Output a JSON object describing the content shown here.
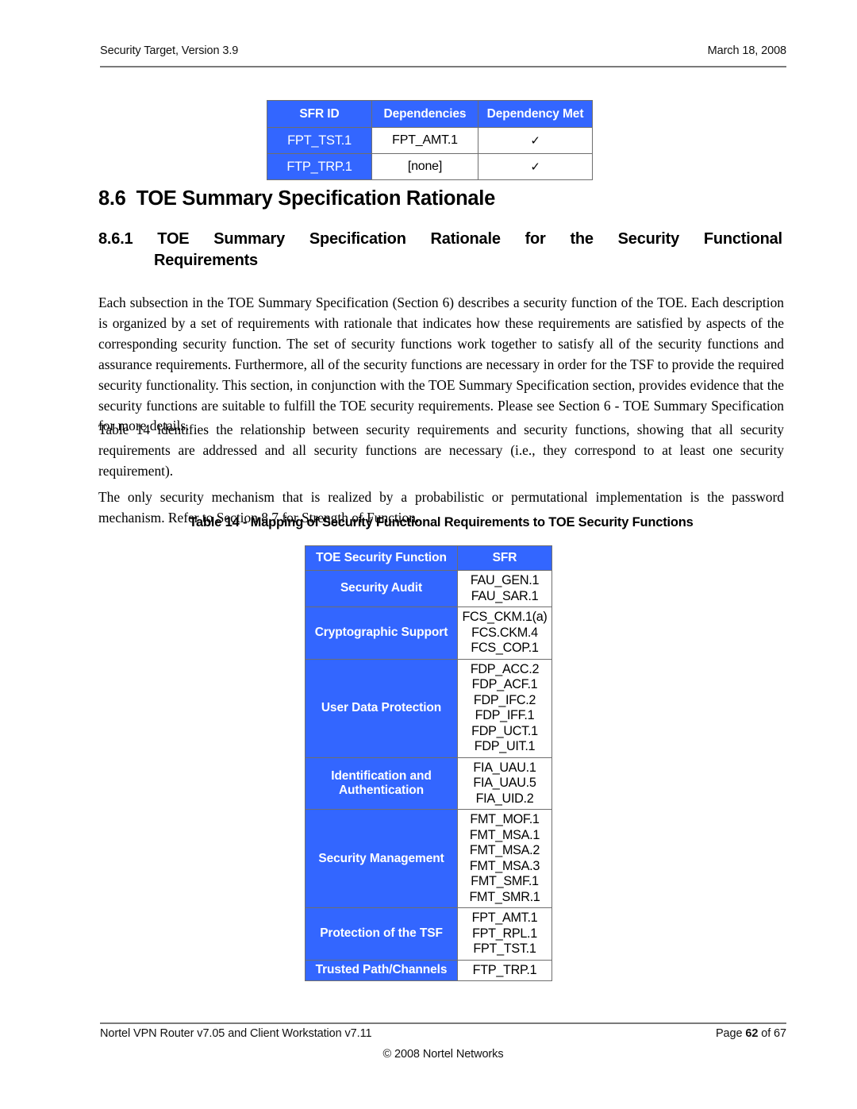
{
  "header": {
    "left": "Security Target, Version 3.9",
    "right": "March 18, 2008"
  },
  "dependency_table": {
    "columns": [
      "SFR ID",
      "Dependencies",
      "Dependency Met"
    ],
    "rows": [
      {
        "sfr_id": "FPT_TST.1",
        "dependencies": "FPT_AMT.1",
        "met": "✓"
      },
      {
        "sfr_id": "FTP_TRP.1",
        "dependencies": "[none]",
        "met": "✓"
      }
    ]
  },
  "heading_8_6": {
    "number": "8.6",
    "text": "TOE Summary Specification Rationale"
  },
  "heading_8_6_1": {
    "number": "8.6.1",
    "line1_words": [
      "TOE",
      "Summary",
      "Specification",
      "Rationale",
      "for",
      "the",
      "Security",
      "Functional"
    ],
    "line2": "Requirements"
  },
  "paragraphs": {
    "p1": "Each subsection in the TOE Summary Specification (Section 6) describes a security function of the TOE.  Each description is organized by a set of requirements with rationale that indicates how these requirements are satisfied by aspects of the corresponding security function.  The set of security functions work together to satisfy all of the security functions and assurance requirements.  Furthermore, all of the security functions are necessary in order for the TSF to provide the required security functionality.  This section, in conjunction with the TOE Summary Specification section, provides evidence that the security functions are suitable to fulfill the TOE security requirements.  Please see Section 6 - TOE Summary Specification for more details.",
    "p2": "Table 14 identifies the relationship between security requirements and security functions, showing that all security requirements are addressed and all security functions are necessary (i.e., they correspond to at least one security requirement).",
    "p3": "The only security mechanism that is realized by a probabilistic or permutational implementation is the password mechanism.  Refer to Section 8.7 for Strength of Function."
  },
  "table14": {
    "caption": "Table 14 - Mapping of Security Functional Requirements to TOE Security Functions",
    "columns": [
      "TOE Security Function",
      "SFR"
    ],
    "rows": [
      {
        "function": "Security Audit",
        "sfrs": [
          "FAU_GEN.1",
          "FAU_SAR.1"
        ]
      },
      {
        "function": "Cryptographic Support",
        "sfrs": [
          "FCS_CKM.1(a)",
          "FCS.CKM.4",
          "FCS_COP.1"
        ]
      },
      {
        "function": "User Data Protection",
        "sfrs": [
          "FDP_ACC.2",
          "FDP_ACF.1",
          "FDP_IFC.2",
          "FDP_IFF.1",
          "FDP_UCT.1",
          "FDP_UIT.1"
        ]
      },
      {
        "function": "Identification and Authentication",
        "function_lines": [
          "Identification and",
          "Authentication"
        ],
        "sfrs": [
          "FIA_UAU.1",
          "FIA_UAU.5",
          "FIA_UID.2"
        ]
      },
      {
        "function": "Security Management",
        "sfrs": [
          "FMT_MOF.1",
          "FMT_MSA.1",
          "FMT_MSA.2",
          "FMT_MSA.3",
          "FMT_SMF.1",
          "FMT_SMR.1"
        ]
      },
      {
        "function": "Protection of the TSF",
        "sfrs": [
          "FPT_AMT.1",
          "FPT_RPL.1",
          "FPT_TST.1"
        ]
      },
      {
        "function": "Trusted Path/Channels",
        "sfrs": [
          "FTP_TRP.1"
        ]
      }
    ]
  },
  "footer": {
    "left": "Nortel VPN Router v7.05 and Client Workstation v7.11",
    "page_prefix": "Page ",
    "page_number": "62",
    "page_suffix": " of 67",
    "copyright": "© 2008 Nortel Networks"
  },
  "colors": {
    "table_blue": "#3366FF",
    "border_gray": "#6e6e6e",
    "rule_gray": "#7a7a7a"
  }
}
